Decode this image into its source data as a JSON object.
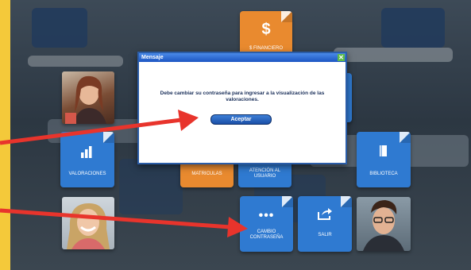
{
  "tiles": {
    "financiero": {
      "label": "$ FINANCIERO",
      "icon": "$"
    },
    "valoraciones": {
      "label": "VALORACIONES",
      "icon": "bar-chart-icon"
    },
    "matriculas": {
      "label": "MATRICULAS"
    },
    "atencion": {
      "label": "ATENCIÓN AL USUARIO"
    },
    "biblioteca": {
      "label": "BIBLIOTECA",
      "icon": "book-icon"
    },
    "cambio_contrasena": {
      "label": "CAMBIO CONTRASEÑA",
      "icon": "ellipsis-icon"
    },
    "salir": {
      "label": "SALIR",
      "icon": "share-arrow-icon"
    }
  },
  "dialog": {
    "title": "Mensaje",
    "close": "✕",
    "message": "Debe cambiar su contraseña para ingresar a la visualización de las valoraciones.",
    "button_label": "Aceptar"
  },
  "colors": {
    "accent_yellow": "#f4c93a",
    "tile_blue": "#2f7ad1",
    "tile_orange": "#e98a2f",
    "arrow_red": "#e8342c",
    "dialog_border": "#2b5da8"
  }
}
